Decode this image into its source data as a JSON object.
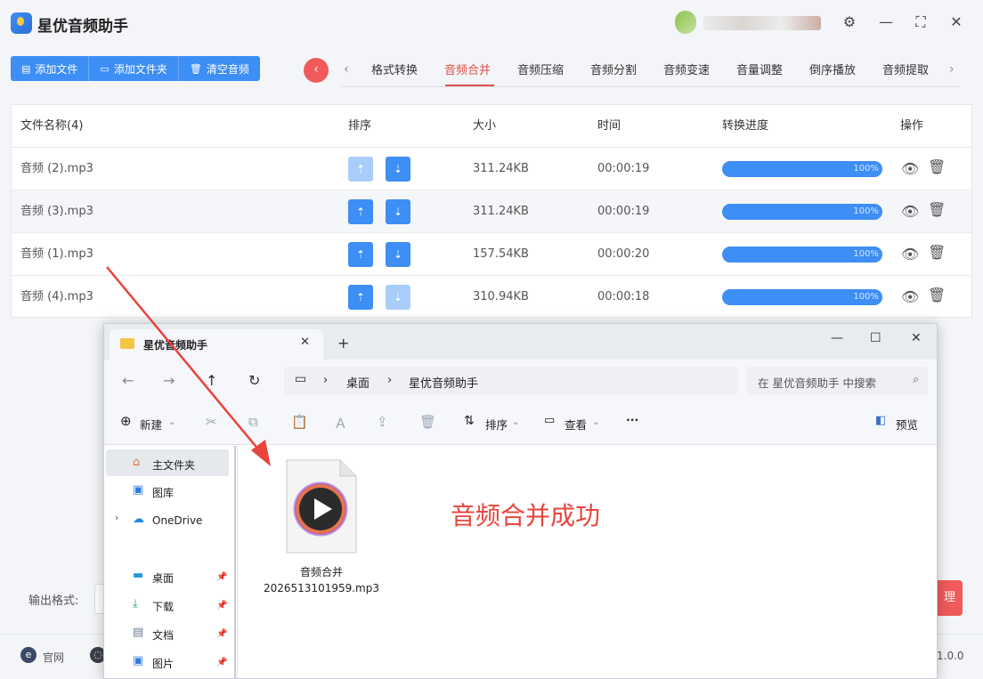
{
  "app": {
    "title": "星优音频助手",
    "version": "1.0.0"
  },
  "toolbar": {
    "add_file": "添加文件",
    "add_folder": "添加文件夹",
    "clear": "清空音频"
  },
  "tabs": [
    "格式转换",
    "音频合并",
    "音频压缩",
    "音频分割",
    "音频变速",
    "音量调整",
    "倒序播放",
    "音频提取"
  ],
  "active_tab": "音频合并",
  "table": {
    "headers": {
      "name": "文件名称(4)",
      "sort": "排序",
      "size": "大小",
      "time": "时间",
      "progress": "转换进度",
      "action": "操作"
    },
    "rows": [
      {
        "name": "音频 (2).mp3",
        "size": "311.24KB",
        "time": "00:00:19",
        "progress_label": "100%",
        "progress": 1.0
      },
      {
        "name": "音频 (3).mp3",
        "size": "311.24KB",
        "time": "00:00:19",
        "progress_label": "100%",
        "progress": 1.0
      },
      {
        "name": "音频 (1).mp3",
        "size": "157.54KB",
        "time": "00:00:20",
        "progress_label": "100%",
        "progress": 1.0
      },
      {
        "name": "音频 (4).mp3",
        "size": "310.94KB",
        "time": "00:00:18",
        "progress_label": "100%",
        "progress": 1.0
      }
    ]
  },
  "bottom": {
    "output_format_label": "输出格式:",
    "merge_btn_partial": "理",
    "footer_site": "官网"
  },
  "explorer": {
    "tab_title": "星优音频助手",
    "breadcrumb": [
      "桌面",
      "星优音频助手"
    ],
    "search_placeholder": "在 星优音频助手 中搜索",
    "commands": {
      "new": "新建",
      "sort": "排序",
      "view": "查看",
      "more": "···",
      "preview": "预览"
    },
    "sidebar": {
      "home": "主文件夹",
      "gallery": "图库",
      "onedrive": "OneDrive",
      "desktop": "桌面",
      "downloads": "下载",
      "documents": "文档",
      "pictures": "图片"
    },
    "file": {
      "name_line1": "音频合并",
      "name_line2": "2026513101959.mp3"
    }
  },
  "annotation": {
    "text": "音频合并成功",
    "color": "#e8443c"
  },
  "colors": {
    "accent": "#3d8ef5",
    "danger": "#f05a5a"
  }
}
